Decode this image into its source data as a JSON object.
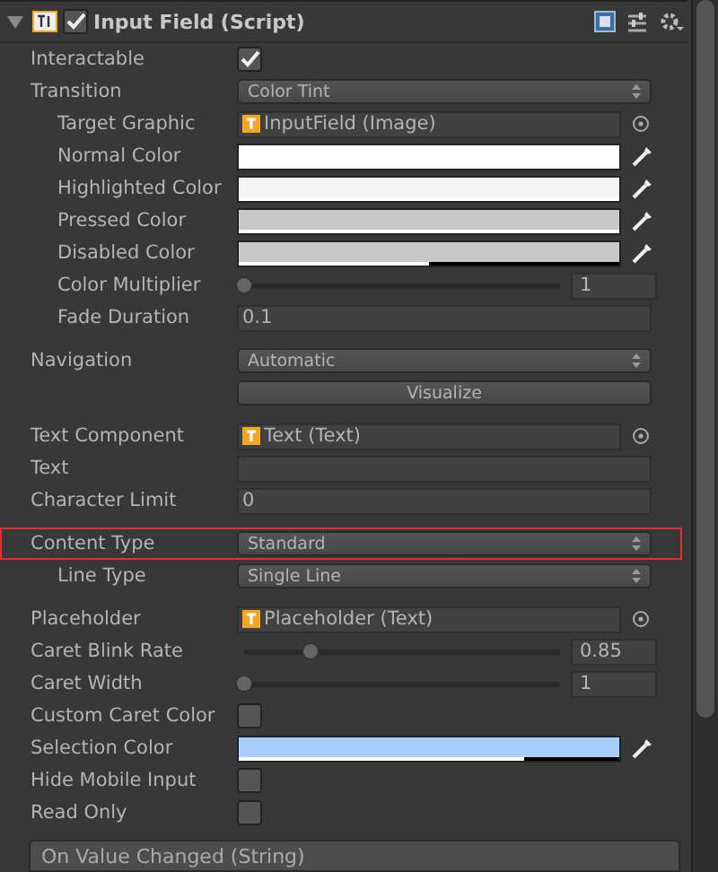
{
  "component": {
    "title": "Input Field (Script)",
    "expanded": true,
    "enabled": true
  },
  "sections": [
    [
      {
        "kind": "checkbox",
        "label": "Interactable",
        "checked": true
      },
      {
        "kind": "dropdown",
        "label": "Transition",
        "value": "Color Tint",
        "children": [
          {
            "kind": "object",
            "label": "Target Graphic",
            "value": "InputField (Image)"
          },
          {
            "kind": "color",
            "label": "Normal Color",
            "color": "#ffffff",
            "level": 1
          },
          {
            "kind": "color",
            "label": "Highlighted Color",
            "color": "#f5f5f5",
            "level": 1
          },
          {
            "kind": "color",
            "label": "Pressed Color",
            "color": "#c8c8c8",
            "level": 1
          },
          {
            "kind": "color",
            "label": "Disabled Color",
            "color": "#c8c8c8",
            "level": 0.5
          },
          {
            "kind": "slider",
            "label": "Color Multiplier",
            "level": 0,
            "value": "1"
          },
          {
            "kind": "text",
            "label": "Fade Duration",
            "value": "0.1"
          }
        ]
      }
    ],
    [
      {
        "kind": "dropdown",
        "label": "Navigation",
        "value": "Automatic"
      },
      {
        "kind": "button",
        "value": "Visualize"
      }
    ],
    [
      {
        "kind": "object",
        "label": "Text Component",
        "value": "Text (Text)"
      },
      {
        "kind": "text",
        "label": "Text"
      },
      {
        "kind": "text",
        "label": "Character Limit",
        "value": "0"
      }
    ],
    [
      {
        "kind": "dropdown",
        "label": "Content Type",
        "value": "Standard",
        "highlighted": true,
        "children": [
          {
            "kind": "dropdown",
            "label": "Line Type",
            "value": "Single Line"
          }
        ]
      }
    ],
    [
      {
        "kind": "object",
        "label": "Placeholder",
        "value": "Placeholder (Text)"
      },
      {
        "kind": "slider",
        "label": "Caret Blink Rate",
        "level": 0.21,
        "value": "0.85"
      },
      {
        "kind": "slider",
        "label": "Caret Width",
        "level": 0,
        "value": "1"
      },
      {
        "kind": "checkbox",
        "label": "Custom Caret Color",
        "checked": false
      },
      {
        "kind": "color",
        "label": "Selection Color",
        "color": "#a8cefe",
        "level": 0.75
      },
      {
        "kind": "checkbox",
        "label": "Hide Mobile Input",
        "checked": false
      },
      {
        "kind": "checkbox",
        "label": "Read Only",
        "checked": false
      }
    ]
  ],
  "event": {
    "title": "On Value Changed (String)"
  }
}
